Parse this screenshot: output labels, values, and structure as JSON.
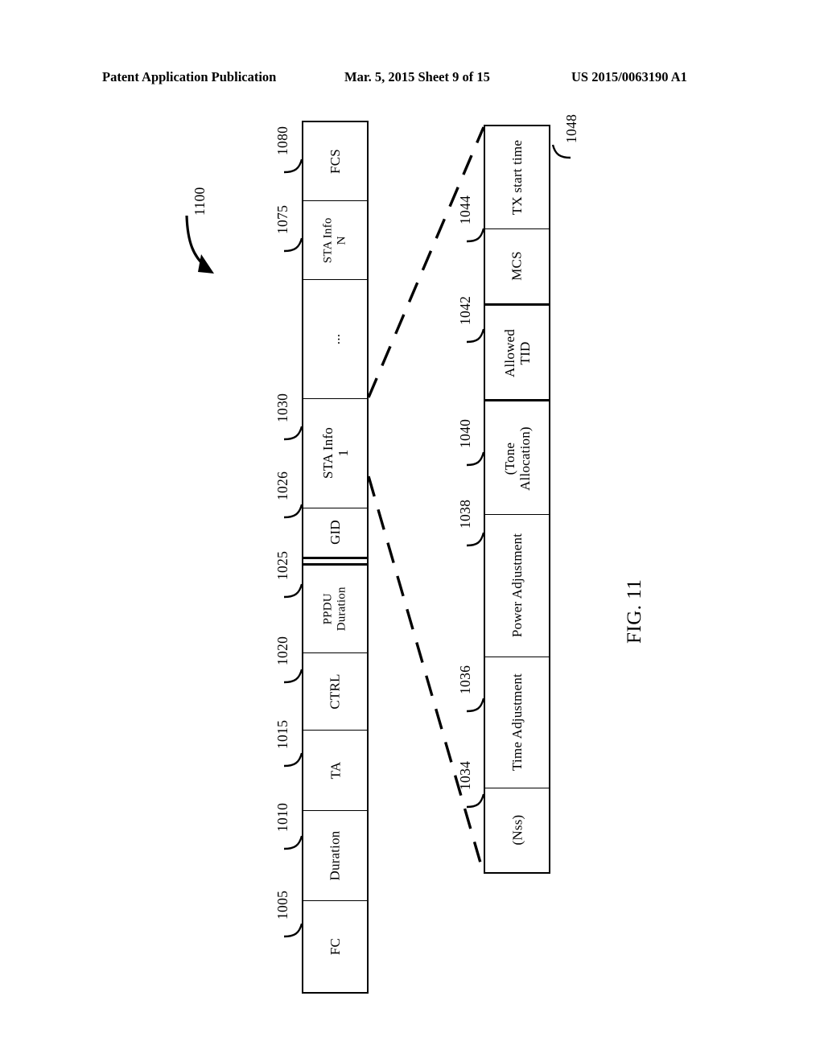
{
  "header": {
    "publication": "Patent Application Publication",
    "date_sheet": "Mar. 5, 2015  Sheet 9 of 15",
    "patent_number": "US 2015/0063190 A1"
  },
  "figure": {
    "caption": "FIG. 11",
    "overall_ref": "1100"
  },
  "frame_main": {
    "name": "trigger-frame-format",
    "fields": [
      {
        "label": "FCS",
        "ref": "1080",
        "lines": [
          "FCS"
        ]
      },
      {
        "label": "STA Info N",
        "ref": "1075",
        "lines": [
          "STA Info",
          "N"
        ]
      },
      {
        "label": "ellipsis",
        "ref": "",
        "lines": [
          "..."
        ]
      },
      {
        "label": "STA Info 1",
        "ref": "1030",
        "lines": [
          "STA Info",
          "1"
        ]
      },
      {
        "label": "GID",
        "ref": "1026",
        "lines": [
          "GID"
        ]
      },
      {
        "label": "PPDU Duration",
        "ref": "1025",
        "lines": [
          "PPDU",
          "Duration"
        ]
      },
      {
        "label": "CTRL",
        "ref": "1020",
        "lines": [
          "CTRL"
        ]
      },
      {
        "label": "TA",
        "ref": "1015",
        "lines": [
          "TA"
        ]
      },
      {
        "label": "Duration",
        "ref": "1010",
        "lines": [
          "Duration"
        ]
      },
      {
        "label": "FC",
        "ref": "1005",
        "lines": [
          "FC"
        ]
      }
    ]
  },
  "frame_sta_info": {
    "name": "sta-info-field-expansion",
    "fields": [
      {
        "label": "TX start time",
        "ref": "1048",
        "lines": [
          "TX start time"
        ]
      },
      {
        "label": "MCS",
        "ref": "1044",
        "lines": [
          "MCS"
        ]
      },
      {
        "label": "Allowed TID",
        "ref": "1042",
        "lines": [
          "Allowed",
          "TID"
        ]
      },
      {
        "label": "(Tone Allocation)",
        "ref": "1040",
        "lines": [
          "(Tone",
          "Allocation)"
        ]
      },
      {
        "label": "Power Adjustment",
        "ref": "1038",
        "lines": [
          "Power Adjustment"
        ]
      },
      {
        "label": "Time Adjustment",
        "ref": "1036",
        "lines": [
          "Time Adjustment"
        ]
      },
      {
        "label": "(Nss)",
        "ref": "1034",
        "lines": [
          "(Nss)"
        ]
      }
    ]
  }
}
